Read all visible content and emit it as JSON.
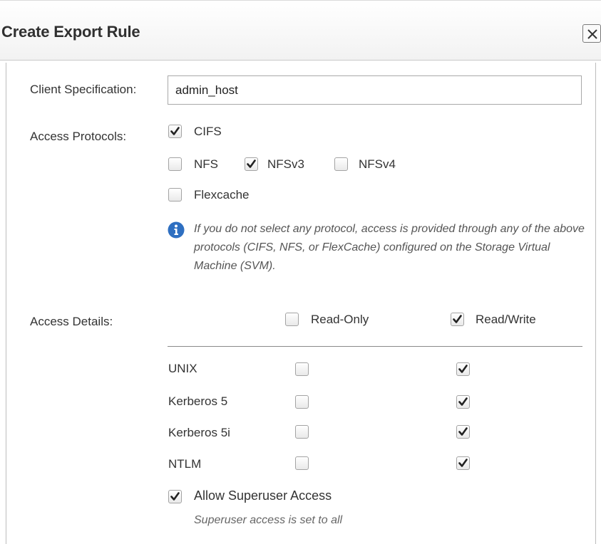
{
  "dialog": {
    "title": "Create Export Rule"
  },
  "icons": {
    "close": "close-icon",
    "info": "info-icon",
    "check": "checkmark-icon"
  },
  "colors": {
    "info_blue": "#2e6fc1",
    "check_dark": "#222222"
  },
  "client_spec": {
    "label": "Client Specification:",
    "value": "admin_host"
  },
  "protocols": {
    "label": "Access Protocols:",
    "items": [
      {
        "label": "CIFS",
        "checked": true
      },
      {
        "label": "NFS",
        "checked": false
      },
      {
        "label": "NFSv3",
        "checked": true
      },
      {
        "label": "NFSv4",
        "checked": false
      },
      {
        "label": "Flexcache",
        "checked": false
      }
    ],
    "info": "If you do not select any protocol, access is provided through any of the above protocols (CIFS, NFS, or FlexCache) configured on the Storage Virtual Machine (SVM)."
  },
  "access_details": {
    "label": "Access Details:",
    "read_only": {
      "label": "Read-Only",
      "checked": false
    },
    "read_write": {
      "label": "Read/Write",
      "checked": true
    },
    "rows": [
      {
        "label": "UNIX",
        "read_only": false,
        "read_write": true
      },
      {
        "label": "Kerberos 5",
        "read_only": false,
        "read_write": true
      },
      {
        "label": "Kerberos 5i",
        "read_only": false,
        "read_write": true
      },
      {
        "label": "NTLM",
        "read_only": false,
        "read_write": true
      }
    ]
  },
  "superuser": {
    "label": "Allow Superuser Access",
    "checked": true,
    "note": "Superuser access is set to all"
  }
}
